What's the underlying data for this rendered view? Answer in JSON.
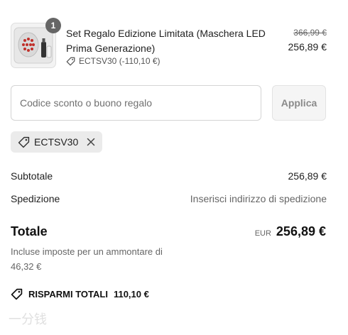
{
  "product": {
    "quantity": "1",
    "name": "Set Regalo Edizione Limitata (Maschera LED Prima Generazione)",
    "discount_code": "ECTSV30 (-110,10 €)",
    "original_price": "366,99 €",
    "price": "256,89 €"
  },
  "discount": {
    "placeholder": "Codice sconto o buono regalo",
    "apply_label": "Applica",
    "applied_code": "ECTSV30"
  },
  "summary": {
    "subtotal_label": "Subtotale",
    "subtotal_value": "256,89 €",
    "shipping_label": "Spedizione",
    "shipping_value": "Inserisci indirizzo di spedizione",
    "total_label": "Totale",
    "currency": "EUR",
    "total_value": "256,89 €",
    "tax_note": "Incluse imposte per un ammontare di 46,32 €",
    "savings_label": "RISPARMI TOTALI",
    "savings_value": "110,10 €"
  },
  "watermark": "一分钱",
  "icons": [
    "product-thumbnail",
    "tag-icon",
    "close-icon"
  ],
  "colors": {
    "text": "#1f1f1f",
    "muted": "#666666",
    "chip_bg": "#ebebeb",
    "badge_bg": "#666666"
  }
}
